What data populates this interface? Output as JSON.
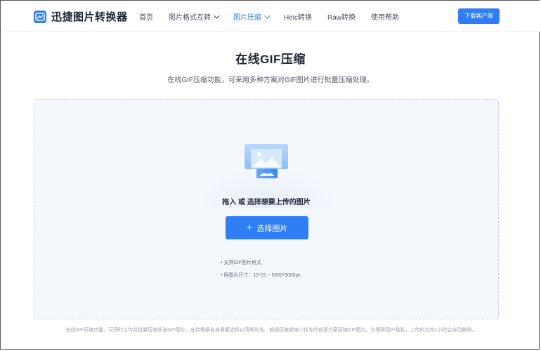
{
  "header": {
    "logo_text": "迅捷图片转换器",
    "nav": [
      {
        "label": "首页"
      },
      {
        "label": "图片格式互转",
        "has_caret": true
      },
      {
        "label": "图片压缩",
        "has_caret": true,
        "active": true
      },
      {
        "label": "Heic转换"
      },
      {
        "label": "Raw转换"
      },
      {
        "label": "使用帮助"
      }
    ],
    "download_label": "下载客户端"
  },
  "main": {
    "title": "在线GIF压缩",
    "subtitle": "在线GIF压缩功能，可采用多种方案对GIF图片进行批量压缩处理。"
  },
  "upload": {
    "drop_text": "拖入 或 选择想要上传的图片",
    "button_label": "选择图片",
    "button_icon": "plus-icon",
    "notes": [
      "• 支持GIF图片格式",
      "• 限图片尺寸：15*15 ~ 5000*5000px"
    ]
  },
  "footer": {
    "note": "在线GIF压缩功能，可同时上传并批量压缩多张GIF图片。支持根据自身需要选择以清晰优先、普通压缩或缩小优先的任意方案压缩GIF图片。为保障用户隐私，上传的文件1小时会自动删除。"
  },
  "colors": {
    "accent": "#2f7ef5",
    "upload_bg": "#f4f7fc",
    "border": "#c9d1e0"
  }
}
